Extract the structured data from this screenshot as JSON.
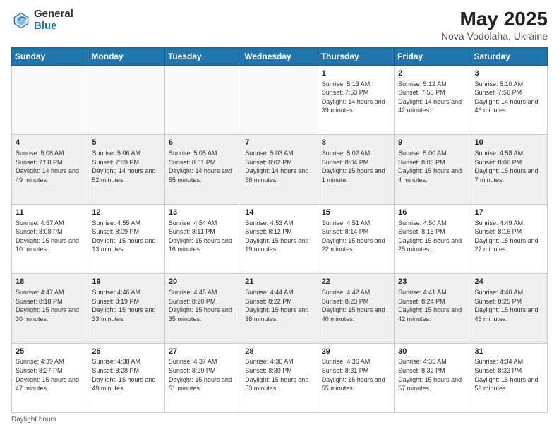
{
  "header": {
    "logo_general": "General",
    "logo_blue": "Blue",
    "title": "May 2025",
    "subtitle": "Nova Vodolaha, Ukraine"
  },
  "days_of_week": [
    "Sunday",
    "Monday",
    "Tuesday",
    "Wednesday",
    "Thursday",
    "Friday",
    "Saturday"
  ],
  "footer": "Daylight hours",
  "weeks": [
    [
      {
        "day": "",
        "sunrise": "",
        "sunset": "",
        "daylight": "",
        "empty": true
      },
      {
        "day": "",
        "sunrise": "",
        "sunset": "",
        "daylight": "",
        "empty": true
      },
      {
        "day": "",
        "sunrise": "",
        "sunset": "",
        "daylight": "",
        "empty": true
      },
      {
        "day": "",
        "sunrise": "",
        "sunset": "",
        "daylight": "",
        "empty": true
      },
      {
        "day": "1",
        "sunrise": "Sunrise: 5:13 AM",
        "sunset": "Sunset: 7:53 PM",
        "daylight": "Daylight: 14 hours and 39 minutes."
      },
      {
        "day": "2",
        "sunrise": "Sunrise: 5:12 AM",
        "sunset": "Sunset: 7:55 PM",
        "daylight": "Daylight: 14 hours and 42 minutes."
      },
      {
        "day": "3",
        "sunrise": "Sunrise: 5:10 AM",
        "sunset": "Sunset: 7:56 PM",
        "daylight": "Daylight: 14 hours and 46 minutes."
      }
    ],
    [
      {
        "day": "4",
        "sunrise": "Sunrise: 5:08 AM",
        "sunset": "Sunset: 7:58 PM",
        "daylight": "Daylight: 14 hours and 49 minutes."
      },
      {
        "day": "5",
        "sunrise": "Sunrise: 5:06 AM",
        "sunset": "Sunset: 7:59 PM",
        "daylight": "Daylight: 14 hours and 52 minutes."
      },
      {
        "day": "6",
        "sunrise": "Sunrise: 5:05 AM",
        "sunset": "Sunset: 8:01 PM",
        "daylight": "Daylight: 14 hours and 55 minutes."
      },
      {
        "day": "7",
        "sunrise": "Sunrise: 5:03 AM",
        "sunset": "Sunset: 8:02 PM",
        "daylight": "Daylight: 14 hours and 58 minutes."
      },
      {
        "day": "8",
        "sunrise": "Sunrise: 5:02 AM",
        "sunset": "Sunset: 8:04 PM",
        "daylight": "Daylight: 15 hours and 1 minute."
      },
      {
        "day": "9",
        "sunrise": "Sunrise: 5:00 AM",
        "sunset": "Sunset: 8:05 PM",
        "daylight": "Daylight: 15 hours and 4 minutes."
      },
      {
        "day": "10",
        "sunrise": "Sunrise: 4:58 AM",
        "sunset": "Sunset: 8:06 PM",
        "daylight": "Daylight: 15 hours and 7 minutes."
      }
    ],
    [
      {
        "day": "11",
        "sunrise": "Sunrise: 4:57 AM",
        "sunset": "Sunset: 8:08 PM",
        "daylight": "Daylight: 15 hours and 10 minutes."
      },
      {
        "day": "12",
        "sunrise": "Sunrise: 4:55 AM",
        "sunset": "Sunset: 8:09 PM",
        "daylight": "Daylight: 15 hours and 13 minutes."
      },
      {
        "day": "13",
        "sunrise": "Sunrise: 4:54 AM",
        "sunset": "Sunset: 8:11 PM",
        "daylight": "Daylight: 15 hours and 16 minutes."
      },
      {
        "day": "14",
        "sunrise": "Sunrise: 4:53 AM",
        "sunset": "Sunset: 8:12 PM",
        "daylight": "Daylight: 15 hours and 19 minutes."
      },
      {
        "day": "15",
        "sunrise": "Sunrise: 4:51 AM",
        "sunset": "Sunset: 8:14 PM",
        "daylight": "Daylight: 15 hours and 22 minutes."
      },
      {
        "day": "16",
        "sunrise": "Sunrise: 4:50 AM",
        "sunset": "Sunset: 8:15 PM",
        "daylight": "Daylight: 15 hours and 25 minutes."
      },
      {
        "day": "17",
        "sunrise": "Sunrise: 4:49 AM",
        "sunset": "Sunset: 8:16 PM",
        "daylight": "Daylight: 15 hours and 27 minutes."
      }
    ],
    [
      {
        "day": "18",
        "sunrise": "Sunrise: 4:47 AM",
        "sunset": "Sunset: 8:18 PM",
        "daylight": "Daylight: 15 hours and 30 minutes."
      },
      {
        "day": "19",
        "sunrise": "Sunrise: 4:46 AM",
        "sunset": "Sunset: 8:19 PM",
        "daylight": "Daylight: 15 hours and 33 minutes."
      },
      {
        "day": "20",
        "sunrise": "Sunrise: 4:45 AM",
        "sunset": "Sunset: 8:20 PM",
        "daylight": "Daylight: 15 hours and 35 minutes."
      },
      {
        "day": "21",
        "sunrise": "Sunrise: 4:44 AM",
        "sunset": "Sunset: 8:22 PM",
        "daylight": "Daylight: 15 hours and 38 minutes."
      },
      {
        "day": "22",
        "sunrise": "Sunrise: 4:42 AM",
        "sunset": "Sunset: 8:23 PM",
        "daylight": "Daylight: 15 hours and 40 minutes."
      },
      {
        "day": "23",
        "sunrise": "Sunrise: 4:41 AM",
        "sunset": "Sunset: 8:24 PM",
        "daylight": "Daylight: 15 hours and 42 minutes."
      },
      {
        "day": "24",
        "sunrise": "Sunrise: 4:40 AM",
        "sunset": "Sunset: 8:25 PM",
        "daylight": "Daylight: 15 hours and 45 minutes."
      }
    ],
    [
      {
        "day": "25",
        "sunrise": "Sunrise: 4:39 AM",
        "sunset": "Sunset: 8:27 PM",
        "daylight": "Daylight: 15 hours and 47 minutes."
      },
      {
        "day": "26",
        "sunrise": "Sunrise: 4:38 AM",
        "sunset": "Sunset: 8:28 PM",
        "daylight": "Daylight: 15 hours and 49 minutes."
      },
      {
        "day": "27",
        "sunrise": "Sunrise: 4:37 AM",
        "sunset": "Sunset: 8:29 PM",
        "daylight": "Daylight: 15 hours and 51 minutes."
      },
      {
        "day": "28",
        "sunrise": "Sunrise: 4:36 AM",
        "sunset": "Sunset: 8:30 PM",
        "daylight": "Daylight: 15 hours and 53 minutes."
      },
      {
        "day": "29",
        "sunrise": "Sunrise: 4:36 AM",
        "sunset": "Sunset: 8:31 PM",
        "daylight": "Daylight: 15 hours and 55 minutes."
      },
      {
        "day": "30",
        "sunrise": "Sunrise: 4:35 AM",
        "sunset": "Sunset: 8:32 PM",
        "daylight": "Daylight: 15 hours and 57 minutes."
      },
      {
        "day": "31",
        "sunrise": "Sunrise: 4:34 AM",
        "sunset": "Sunset: 8:33 PM",
        "daylight": "Daylight: 15 hours and 59 minutes."
      }
    ]
  ]
}
